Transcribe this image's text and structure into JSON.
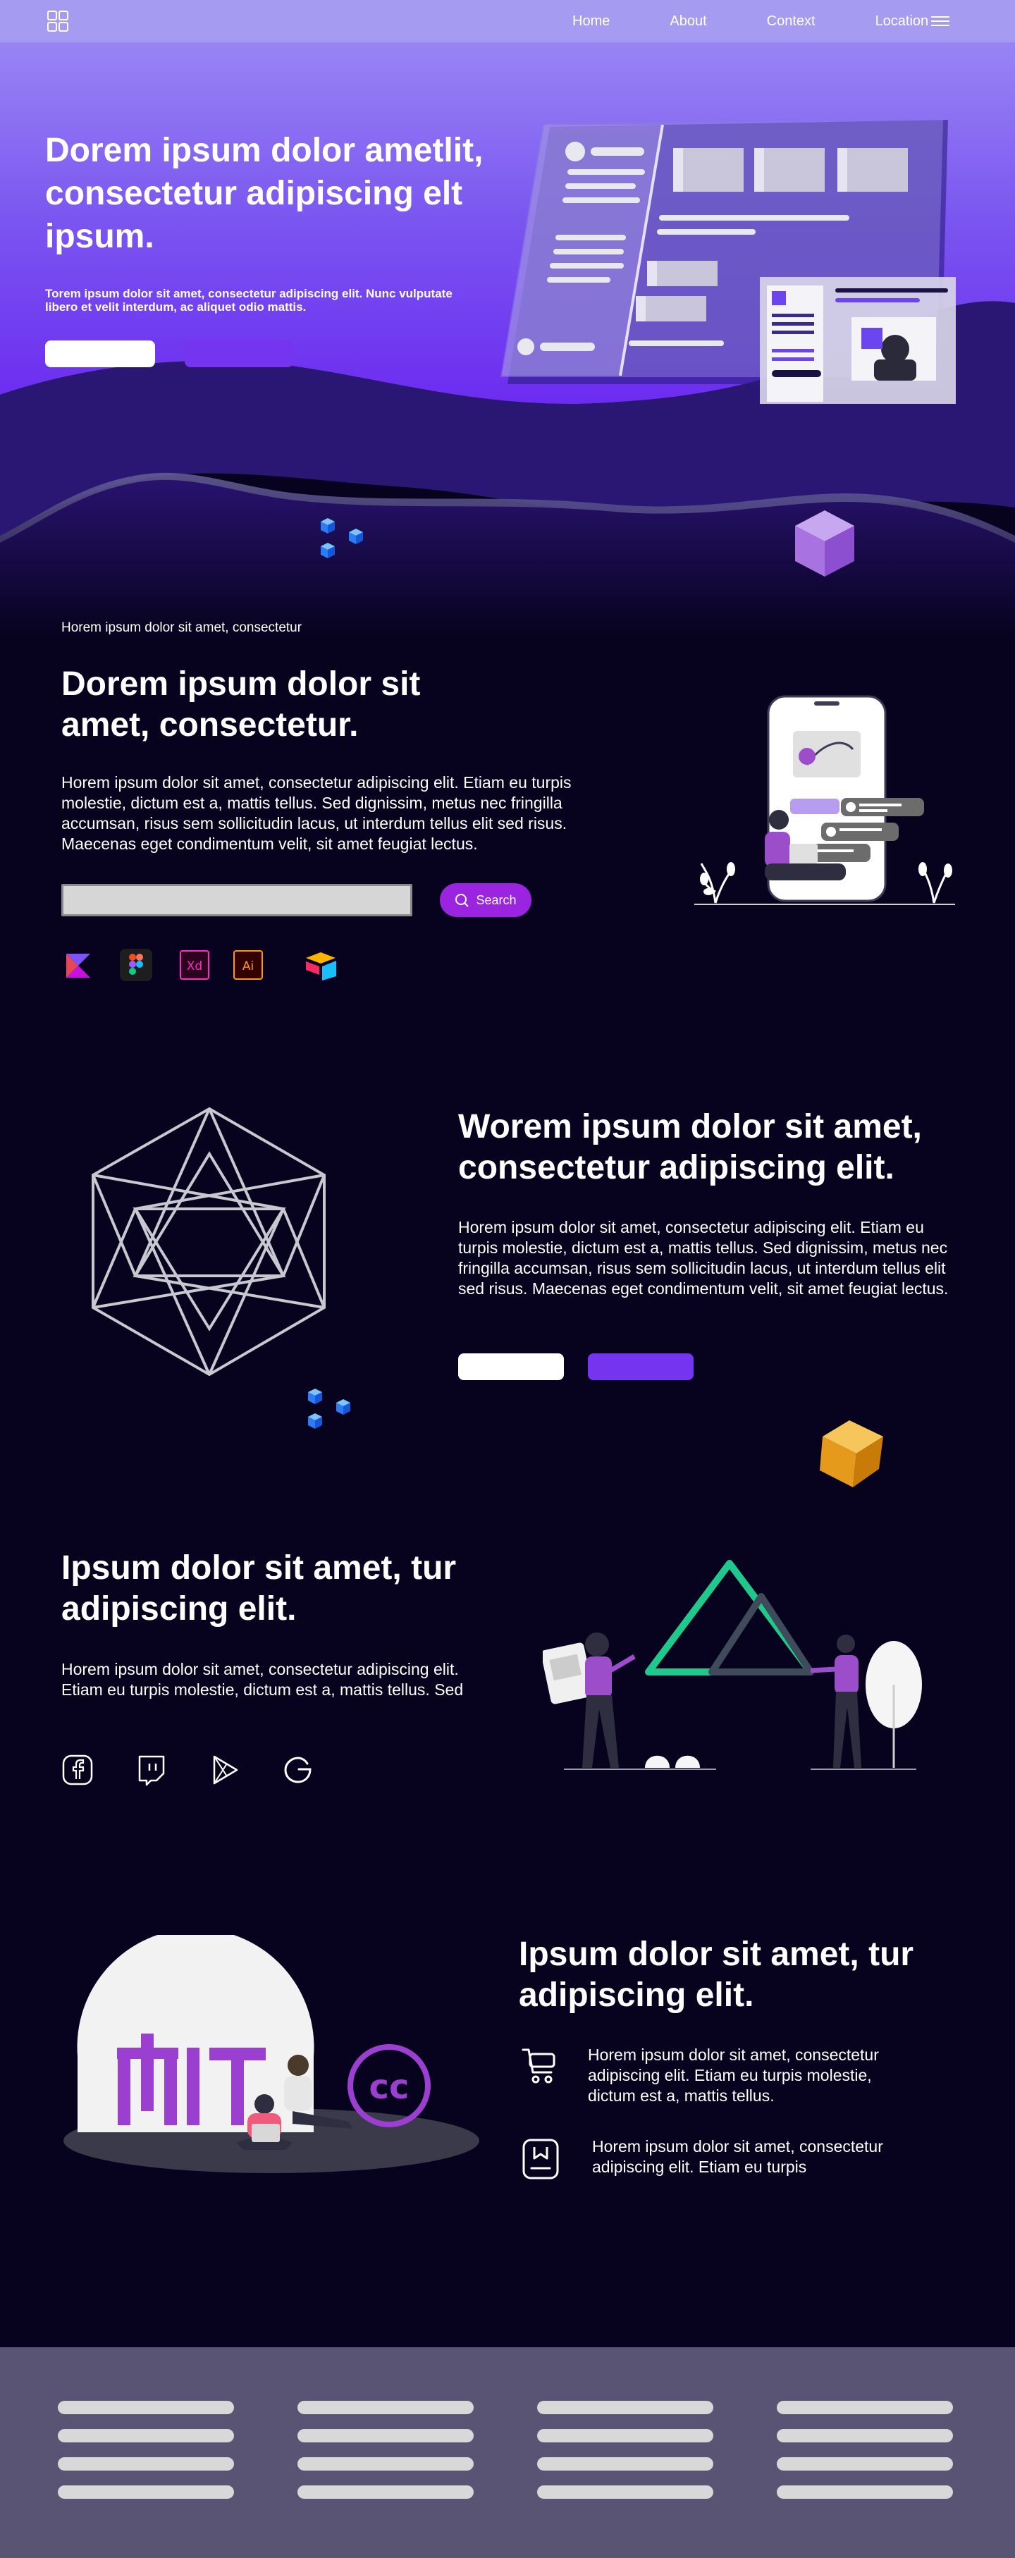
{
  "nav": {
    "links": [
      "Home",
      "About",
      "Context",
      "Location"
    ]
  },
  "hero": {
    "title": "Dorem ipsum dolor  ametlit, consectetur adipiscing elt ipsum.",
    "subtitle": "Torem ipsum dolor sit amet, consectetur adipiscing elit. Nunc vulputate libero et velit interdum, ac aliquet odio mattis."
  },
  "section1": {
    "eyebrow": "Horem ipsum dolor sit amet, consectetur",
    "title": "Dorem ipsum dolor sit amet, consectetur.",
    "body": "Horem ipsum dolor sit amet, consectetur adipiscing elit. Etiam eu turpis molestie, dictum est a, mattis tellus. Sed dignissim, metus nec fringilla accumsan, risus sem sollicitudin lacus, ut interdum tellus elit sed risus. Maecenas eget condimentum velit, sit amet feugiat lectus.",
    "search_label": "Search",
    "tools": [
      "kotlin-icon",
      "figma-icon",
      "adobe-xd-icon",
      "adobe-illustrator-icon",
      "airtable-icon"
    ]
  },
  "section2": {
    "title": "Worem ipsum dolor sit amet, consectetur adipiscing elit.",
    "body": "Horem ipsum dolor sit amet, consectetur adipiscing elit. Etiam eu turpis molestie, dictum est a, mattis tellus. Sed dignissim, metus nec fringilla accumsan, risus sem sollicitudin lacus, ut interdum tellus elit sed risus. Maecenas eget condimentum velit, sit amet feugiat lectus."
  },
  "section3": {
    "title": "Ipsum dolor sit amet, tur adipiscing elit.",
    "body": "Horem ipsum dolor sit amet, consectetur adipiscing elit. Etiam eu turpis molestie, dictum est a, mattis tellus. Sed",
    "social": [
      "facebook-icon",
      "twitch-icon",
      "play-icon",
      "google-icon"
    ]
  },
  "section4": {
    "title": "Ipsum dolor sit amet, tur adipiscing elit.",
    "features": [
      {
        "icon": "cart-icon",
        "text": "Horem ipsum dolor sit amet, consectetur adipiscing elit. Etiam eu turpis molestie, dictum est a, mattis tellus."
      },
      {
        "icon": "bookmark-icon",
        "text": "Horem ipsum dolor sit amet, consectetur adipiscing elit. Etiam eu turpis"
      }
    ]
  },
  "colors": {
    "nav_bg": "#a59cf1",
    "hero_top": "#8a72f2",
    "page_bg": "#07031f",
    "accent_purple": "#7535f0",
    "search_button": "#9b24e0",
    "footer_bg": "#595473"
  }
}
